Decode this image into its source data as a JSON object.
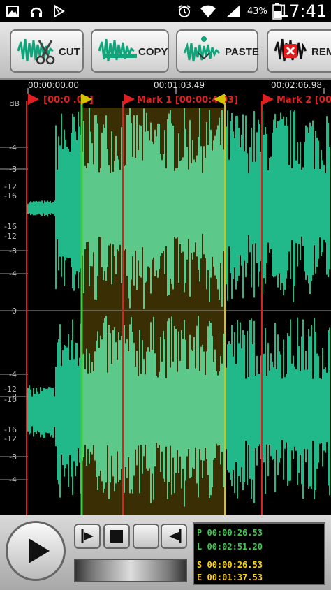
{
  "status_bar": {
    "time": "17:41",
    "battery": "43%",
    "icons": [
      "image-icon",
      "headset-icon",
      "play-store-icon",
      "alarm-icon",
      "wifi-icon",
      "signal-icon",
      "battery-icon"
    ]
  },
  "toolbar": {
    "cut_label": "CUT",
    "copy_label": "COPY",
    "paste_label": "PASTE",
    "remove_label": "REM"
  },
  "timeline": {
    "time_labels": [
      "00:00:00.00",
      "00:01:03.49",
      "00:02:06.98"
    ],
    "marks": [
      {
        "label": "[00:00:00.00]",
        "visible_label": "[00:0    .00]"
      },
      {
        "label": "Mark 1 [00:00:4    03]"
      },
      {
        "label": "Mark 2 [00"
      }
    ],
    "db_unit": "dB",
    "db_labels_top": [
      "-4",
      "-8",
      "-12",
      "-16",
      "-16",
      "-12",
      "-8",
      "-4",
      "0"
    ],
    "db_labels_bottom": [
      "-4",
      "-8",
      "-12",
      "-16",
      "-16",
      "-12",
      "-8",
      "-4"
    ]
  },
  "info": {
    "rows": [
      {
        "key": "P",
        "value": "00:00:26.53",
        "color": "#3ec94a"
      },
      {
        "key": "L",
        "value": "00:02:51.20",
        "color": "#3ec94a"
      },
      {
        "key": "S",
        "value": "00:00:26.53",
        "color": "#ffd400"
      },
      {
        "key": "E",
        "value": "00:01:37.53",
        "color": "#ffd400"
      }
    ]
  },
  "colors": {
    "wave": "#21b88a",
    "wave_selected": "#5cc98a",
    "selection_bg": "#3a2e05",
    "mark": "#e02020",
    "selection_edge": "#d4c400"
  }
}
